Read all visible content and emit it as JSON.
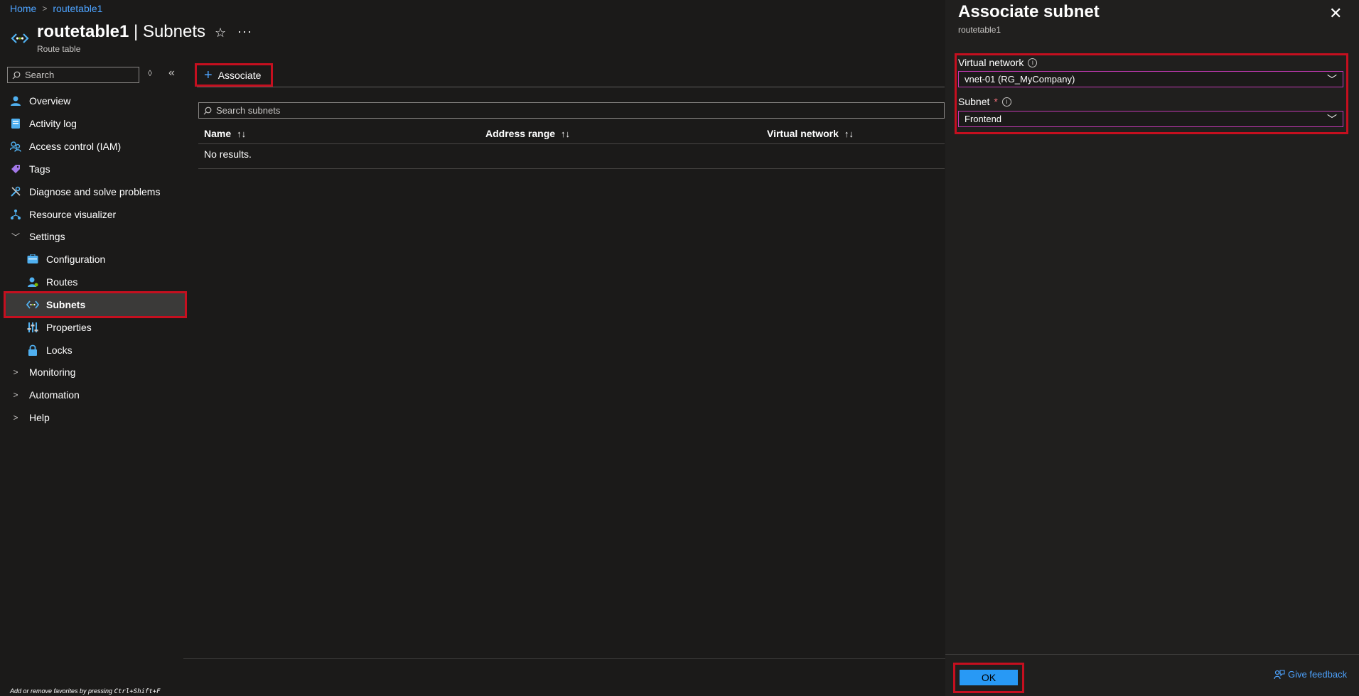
{
  "breadcrumb": {
    "home": "Home",
    "current": "routetable1"
  },
  "header": {
    "resource_name": "routetable1",
    "separator": " | ",
    "page": "Subnets",
    "subtitle": "Route table",
    "icon": "route-table-icon",
    "favorite_icon": "star-icon",
    "more_icon": "ellipsis-icon"
  },
  "sidebar": {
    "search_placeholder": "Search",
    "items": [
      {
        "label": "Overview",
        "icon": "overview-icon"
      },
      {
        "label": "Activity log",
        "icon": "activity-log-icon"
      },
      {
        "label": "Access control (IAM)",
        "icon": "iam-icon"
      },
      {
        "label": "Tags",
        "icon": "tag-icon"
      },
      {
        "label": "Diagnose and solve problems",
        "icon": "wrench-icon"
      },
      {
        "label": "Resource visualizer",
        "icon": "visualizer-icon"
      },
      {
        "label": "Settings",
        "icon": "chevron-down-icon"
      },
      {
        "label": "Configuration",
        "icon": "configuration-icon"
      },
      {
        "label": "Routes",
        "icon": "routes-icon"
      },
      {
        "label": "Subnets",
        "icon": "subnets-icon"
      },
      {
        "label": "Properties",
        "icon": "properties-icon"
      },
      {
        "label": "Locks",
        "icon": "lock-icon"
      },
      {
        "label": "Monitoring",
        "icon": "chevron-right-icon"
      },
      {
        "label": "Automation",
        "icon": "chevron-right-icon"
      },
      {
        "label": "Help",
        "icon": "chevron-right-icon"
      }
    ],
    "favorites_hint_prefix": "Add or remove favorites by pressing ",
    "favorites_hint_keys": "Ctrl+Shift+F"
  },
  "toolbar": {
    "associate_label": "Associate"
  },
  "main": {
    "search_placeholder": "Search subnets",
    "columns": [
      "Name",
      "Address range",
      "Virtual network"
    ],
    "empty_text": "No results."
  },
  "panel": {
    "title": "Associate subnet",
    "subtitle": "routetable1",
    "vnet_label": "Virtual network",
    "vnet_value": "vnet-01 (RG_MyCompany)",
    "subnet_label": "Subnet",
    "required_mark": "*",
    "subnet_value": "Frontend",
    "ok_label": "OK",
    "feedback_label": "Give feedback"
  },
  "colors": {
    "background": "#1b1a19",
    "panel": "#201f1e",
    "accent": "#2899f5",
    "link": "#4da3ff",
    "highlight": "#c50f1f"
  }
}
